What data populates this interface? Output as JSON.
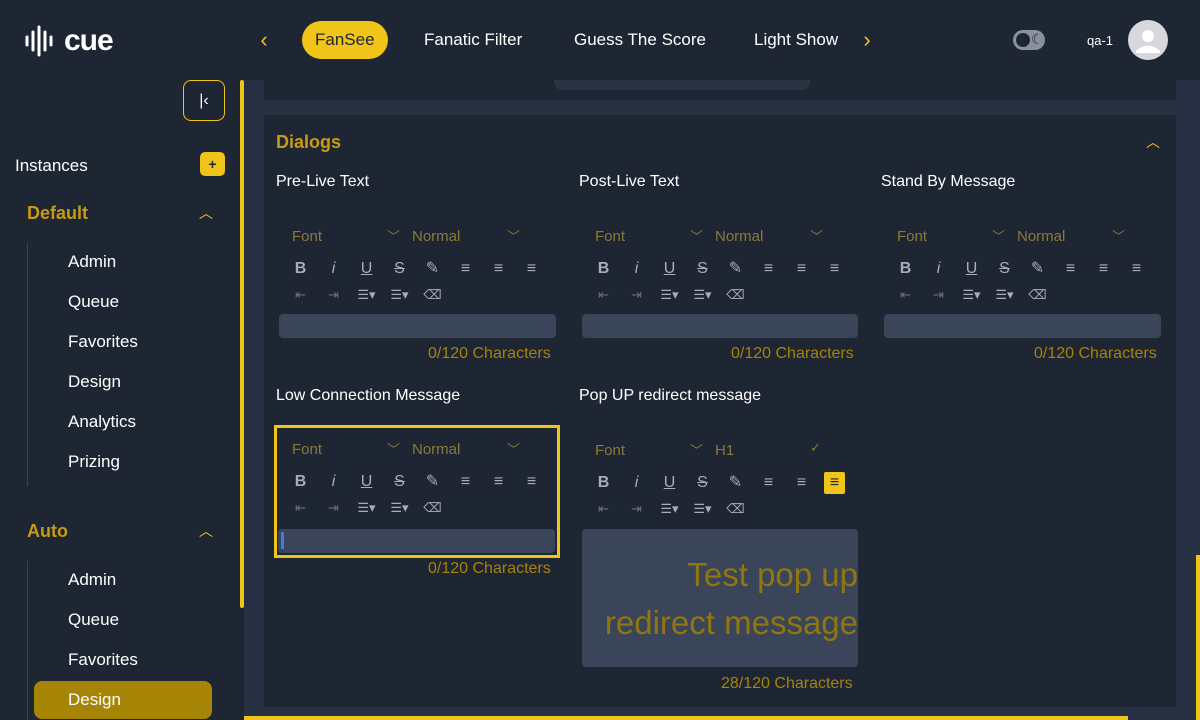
{
  "app": {
    "logo_text": "cue"
  },
  "nav": {
    "tabs": [
      {
        "label": "FanSee",
        "active": true
      },
      {
        "label": "Fanatic Filter"
      },
      {
        "label": "Guess The Score"
      },
      {
        "label": "Light Show"
      }
    ]
  },
  "user": {
    "name": "qa-1"
  },
  "sidebar": {
    "instances_label": "Instances",
    "add_label": "+",
    "groups": [
      {
        "title": "Default",
        "items": [
          "Admin",
          "Queue",
          "Favorites",
          "Design",
          "Analytics",
          "Prizing"
        ]
      },
      {
        "title": "Auto",
        "items": [
          "Admin",
          "Queue",
          "Favorites",
          "Design"
        ],
        "active_item": "Design"
      }
    ]
  },
  "panel": {
    "title": "Dialogs",
    "editors": [
      {
        "label": "Pre-Live Text",
        "font": "Font",
        "size": "Normal",
        "text": "",
        "counter": "0/120 Characters"
      },
      {
        "label": "Post-Live Text",
        "font": "Font",
        "size": "Normal",
        "text": "",
        "counter": "0/120 Characters"
      },
      {
        "label": "Stand By Message",
        "font": "Font",
        "size": "Normal",
        "text": "",
        "counter": "0/120 Characters"
      },
      {
        "label": "Low Connection Message",
        "font": "Font",
        "size": "Normal",
        "text": "",
        "counter": "0/120 Characters",
        "focused": true
      },
      {
        "label": "Pop UP redirect message",
        "font": "Font",
        "size": "H1",
        "text": "Test pop up redirect message",
        "counter": "28/120 Characters",
        "align": "right"
      }
    ]
  },
  "colors": {
    "accent": "#f0c419",
    "background": "#1e2533",
    "muted_gold": "#a68406"
  }
}
